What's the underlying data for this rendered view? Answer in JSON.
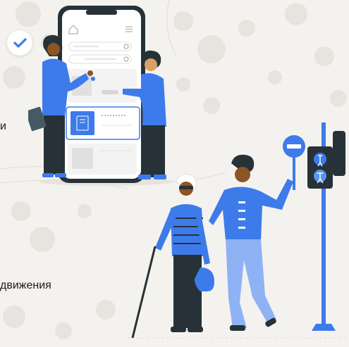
{
  "text_fragments": {
    "line1": "и",
    "line2": "движения"
  },
  "icons": {
    "badge": "check-icon",
    "phone_home": "home-icon",
    "phone_menu": "menu-icon",
    "search_1": "search-icon",
    "search_2": "refresh-icon",
    "sign": "no-entry-sign-icon",
    "traffic_light": "pedestrian-traffic-light-icon"
  },
  "colors": {
    "accent_blue": "#3d7bea",
    "dark": "#263238",
    "background": "#f4f2ef"
  }
}
